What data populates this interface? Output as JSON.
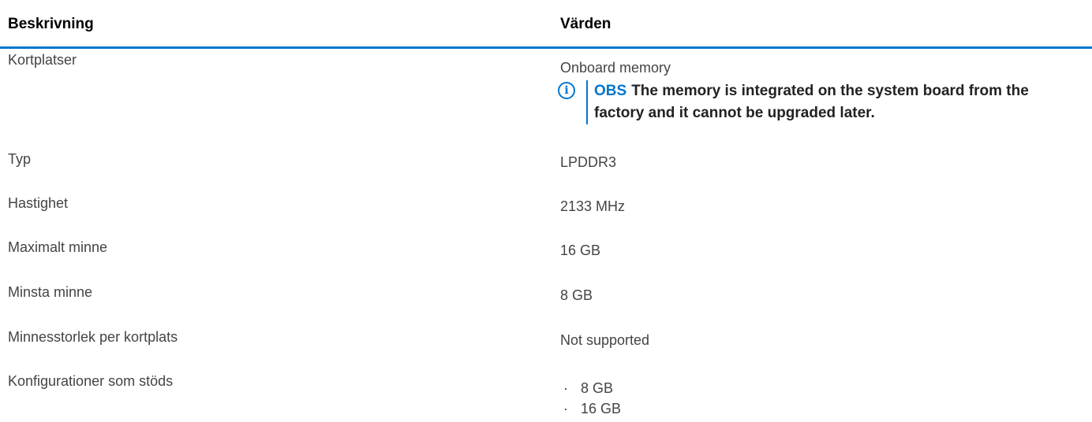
{
  "header": {
    "description_label": "Beskrivning",
    "values_label": "Värden"
  },
  "rows": [
    {
      "description": "Kortplatser",
      "value": "Onboard memory",
      "note": {
        "label": "OBS",
        "text": "The memory is integrated on the system board from the factory and it cannot be upgraded later."
      }
    },
    {
      "description": "Typ",
      "value": "LPDDR3"
    },
    {
      "description": "Hastighet",
      "value": "2133 MHz"
    },
    {
      "description": "Maximalt minne",
      "value": "16 GB"
    },
    {
      "description": "Minsta minne",
      "value": "8 GB"
    },
    {
      "description": "Minnesstorlek per kortplats",
      "value": "Not supported"
    },
    {
      "description": "Konfigurationer som stöds",
      "values": [
        "8 GB",
        "16 GB"
      ]
    }
  ],
  "colors": {
    "accent": "#0076ce"
  },
  "icons": {
    "note_icon": "info-circle-icon",
    "bullet": "·"
  }
}
